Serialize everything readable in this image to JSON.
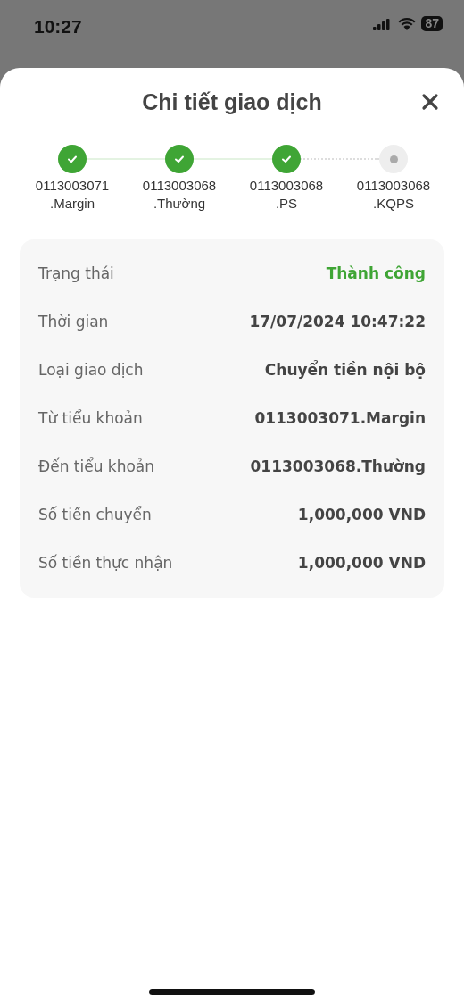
{
  "status_bar": {
    "time": "10:27",
    "battery": "87"
  },
  "sheet": {
    "title": "Chi tiết giao dịch"
  },
  "steps": [
    {
      "account": "0113003071",
      "suffix": ".Margin",
      "done": true
    },
    {
      "account": "0113003068",
      "suffix": ".Thường",
      "done": true
    },
    {
      "account": "0113003068",
      "suffix": ".PS",
      "done": true
    },
    {
      "account": "0113003068",
      "suffix": ".KQPS",
      "done": false
    }
  ],
  "details": [
    {
      "kind": "status",
      "label": "Trạng thái",
      "value": "Thành công"
    },
    {
      "kind": "plain",
      "label": "Thời gian",
      "value": "17/07/2024 10:47:22"
    },
    {
      "kind": "plain",
      "label": "Loại giao dịch",
      "value": "Chuyển tiền nội bộ"
    },
    {
      "kind": "plain",
      "label": "Từ tiểu khoản",
      "value": "0113003071.Margin"
    },
    {
      "kind": "plain",
      "label": "Đến tiểu khoản",
      "value": "0113003068.Thường"
    },
    {
      "kind": "plain",
      "label": "Số tiền chuyển",
      "value": "1,000,000 VND"
    },
    {
      "kind": "plain",
      "label": "Số tiền thực nhận",
      "value": "1,000,000 VND"
    }
  ]
}
